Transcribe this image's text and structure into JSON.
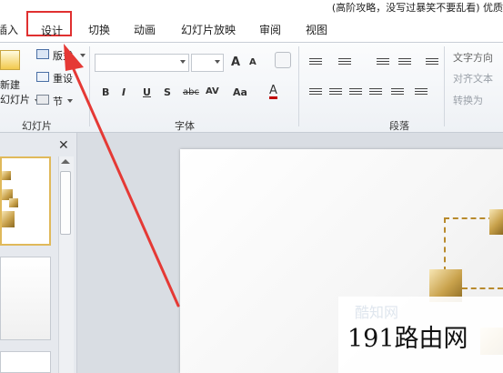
{
  "title_text": "(高阶攻略，没写过暴笑不要乱看) 优质",
  "tabs": {
    "insert": "插入",
    "design": "设计",
    "transitions": "切换",
    "animations": "动画",
    "slideshow": "幻灯片放映",
    "review": "审阅",
    "view": "视图"
  },
  "ribbon": {
    "slides_group": {
      "new_slide_line1": "新建",
      "new_slide_line2": "幻灯片",
      "layout": "版式",
      "reset": "重设",
      "section": "节",
      "label": "幻灯片"
    },
    "font_group": {
      "grow": "A",
      "shrink": "A",
      "bold": "B",
      "italic": "I",
      "underline": "U",
      "shadow": "S",
      "strikethrough": "abc",
      "spacing": "AV",
      "case": "Aa",
      "color": "A",
      "label": "字体"
    },
    "para_group": {
      "text_direction": "文字方向",
      "align_text": "对齐文本",
      "convert": "转换为",
      "label": "段落"
    }
  },
  "watermark": "191路由网",
  "watermark_faint": "酷知网",
  "colors": {
    "highlight": "#e03030",
    "gold": "#c9a24c"
  }
}
